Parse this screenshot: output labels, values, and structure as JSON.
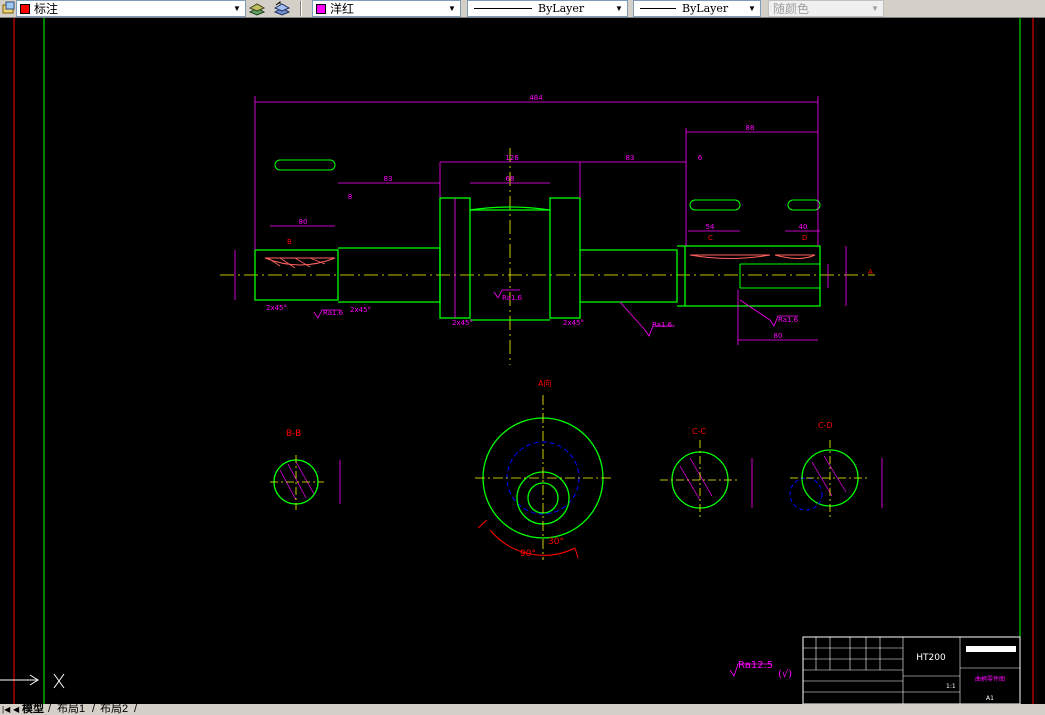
{
  "toolbar": {
    "layer_name": "标注",
    "layer_color": "#ff0000",
    "color_name": "洋红",
    "color_value": "#ff00ff",
    "linetype": "ByLayer",
    "lineweight": "ByLayer",
    "plotstyle": "随颜色"
  },
  "drawing": {
    "dim_total": "484",
    "dim_right_total": "88",
    "dim_crank_width": "126",
    "dim_crank_inner": "68",
    "dim_seg_left": "83",
    "dim_seg_right": "83",
    "dim_gap_left": "8",
    "dim_gap_right": "6",
    "dim_key_left_len": "80",
    "dim_key_right_len1": "54",
    "dim_key_right_len2": "40",
    "dim_bottom_right": "80",
    "chamfer_1": "2x45°",
    "chamfer_2": "2x45°",
    "chamfer_3": "2x45°",
    "chamfer_4": "2x45°",
    "rough_1": "Ra1.6",
    "rough_2": "Ra1.6",
    "rough_3": "Ra1.6",
    "rough_4": "Ra1.6",
    "sec_label_b": "B",
    "sec_label_c": "C",
    "sec_label_d": "D",
    "section_bb": "B-B",
    "section_cc": "C-C",
    "section_cd": "C-D",
    "view_a": "A向",
    "view_a_marker": "A",
    "angle_90": "90°",
    "angle_30": "30°",
    "general_roughness": "Ra12.5",
    "roughness_paren": "(√)"
  },
  "title_block": {
    "material": "HT200",
    "part_title": "曲柄零件图",
    "sheet_size": "A1",
    "scale": "1:1"
  },
  "tabs": [
    "模型",
    "布局1",
    "布局2"
  ]
}
